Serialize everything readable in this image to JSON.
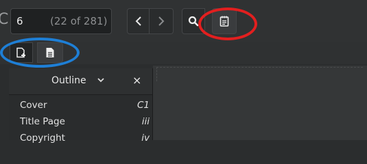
{
  "toolbar": {
    "edge_glyph": "C",
    "page_input_value": "6",
    "page_count": "(22 of 281)",
    "icons": [
      "chevron-left-icon",
      "chevron-right-icon",
      "search-icon",
      "annotations-icon"
    ]
  },
  "secondary_toolbar": {
    "icons": [
      "add-annotation-icon",
      "document-icon"
    ]
  },
  "sidebar": {
    "title": "Outline",
    "close_label": "×",
    "items": [
      {
        "title": "Cover",
        "page": "C1"
      },
      {
        "title": "Title Page",
        "page": "iii"
      },
      {
        "title": "Copyright",
        "page": "iv"
      }
    ]
  },
  "highlights": {
    "red": "#e21f1f",
    "blue": "#1e7fd6"
  }
}
